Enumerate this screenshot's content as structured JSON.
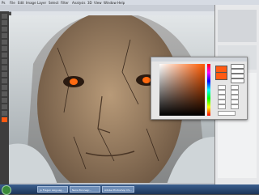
{
  "menubar": {
    "items": [
      "Ps",
      "File",
      "Edit",
      "Image",
      "Layer",
      "Select",
      "Filter",
      "Analysis",
      "3D",
      "View",
      "Window",
      "Help"
    ]
  },
  "color_picker": {
    "new_color": "#ff5a12",
    "current_color": "#ff5a12"
  },
  "taskbar": {
    "start_icon": "windows-orb",
    "tasks": [
      {
        "label": "Ju Fragen zeig.sag..."
      },
      {
        "label": "Nena Bonnegr..."
      },
      {
        "label": "Adobe Photoshop CS..."
      }
    ]
  }
}
